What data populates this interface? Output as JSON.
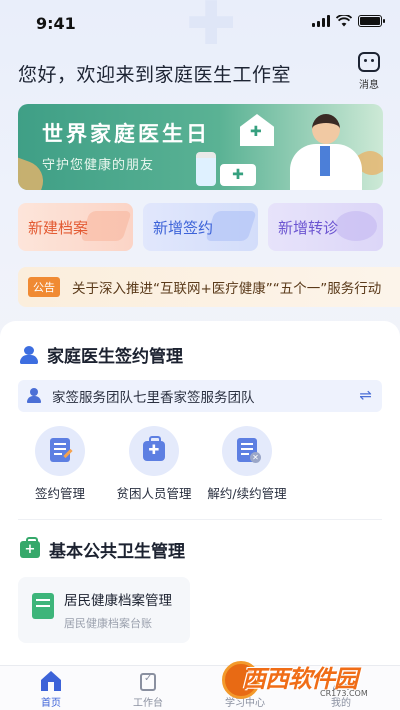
{
  "status_bar": {
    "time": "9:41"
  },
  "header": {
    "greeting": "您好，欢迎来到家庭医生工作室",
    "message_label": "消息"
  },
  "banner": {
    "title": "世界家庭医生日",
    "subtitle": "守护您健康的朋友"
  },
  "quick_actions": [
    {
      "label": "新建档案",
      "color": "#e35a32"
    },
    {
      "label": "新增签约",
      "color": "#3d63d8"
    },
    {
      "label": "新增转诊",
      "color": "#6c55d1"
    }
  ],
  "notice": {
    "tag": "公告",
    "text": "关于深入推进“互联网+医疗健康”“五个一”服务行动"
  },
  "sign_section": {
    "title": "家庭医生签约管理",
    "team": "家签服务团队七里香家签服务团队",
    "items": [
      {
        "label": "签约管理",
        "icon": "sign-document-icon"
      },
      {
        "label": "贫困人员管理",
        "icon": "medical-bag-icon"
      },
      {
        "label": "解约/续约管理",
        "icon": "cancel-document-icon"
      }
    ]
  },
  "public_health": {
    "title": "基本公共卫生管理",
    "card": {
      "title": "居民健康档案管理",
      "subtitle": "居民健康档案台账"
    }
  },
  "tabbar": {
    "tabs": [
      {
        "label": "首页",
        "active": true
      },
      {
        "label": "工作台",
        "active": false
      },
      {
        "label": "学习中心",
        "active": false
      },
      {
        "label": "我的",
        "active": false
      }
    ]
  },
  "watermark": {
    "logo_text": "西西软件园",
    "url": "CR173.COM"
  },
  "colors": {
    "primary": "#3d63d8",
    "banner_green": "#3f9f86",
    "notice_tag": "#f08a33",
    "health_green": "#35a86a"
  }
}
